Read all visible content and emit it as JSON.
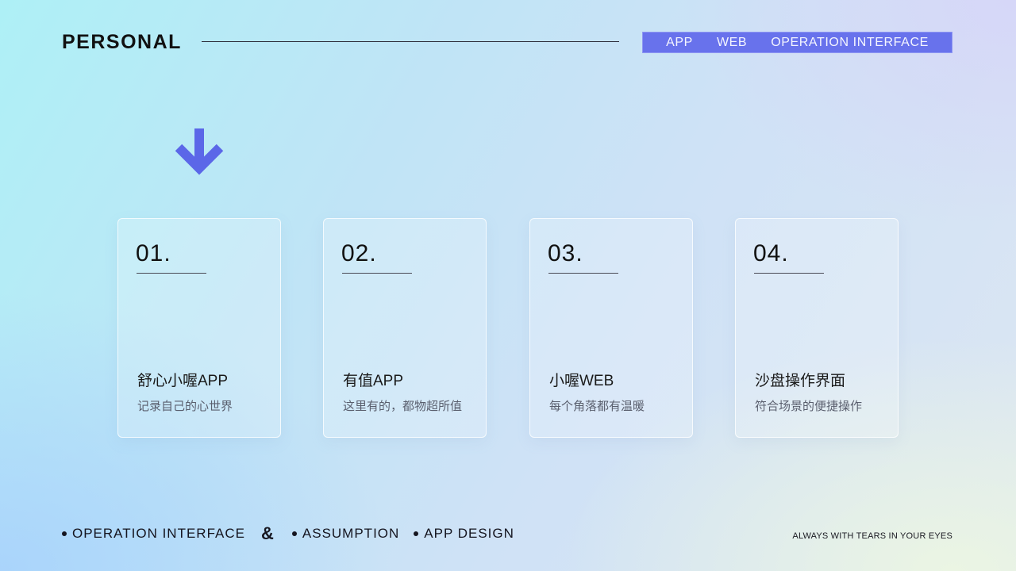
{
  "header": {
    "brand": "PERSONAL",
    "nav": [
      "APP",
      "WEB",
      "OPERATION INTERFACE"
    ]
  },
  "cards": [
    {
      "num": "01.",
      "title": "舒心小喔APP",
      "desc": "记录自己的心世界"
    },
    {
      "num": "02.",
      "title": "有值APP",
      "desc": "这里有的，都物超所值"
    },
    {
      "num": "03.",
      "title": "小喔WEB",
      "desc": "每个角落都有温暖"
    },
    {
      "num": "04.",
      "title": "沙盘操作界面",
      "desc": "符合场景的便捷操作"
    }
  ],
  "footer": {
    "item1": "OPERATION INTERFACE",
    "amp": "&",
    "item2": "ASSUMPTION",
    "item3": "APP DESIGN",
    "tagline": "ALWAYS WITH TEARS IN YOUR EYES"
  },
  "icons": {
    "arrow": "arrow-down-icon"
  },
  "colors": {
    "accent": "#6872ec",
    "arrow": "#5b67e8"
  }
}
